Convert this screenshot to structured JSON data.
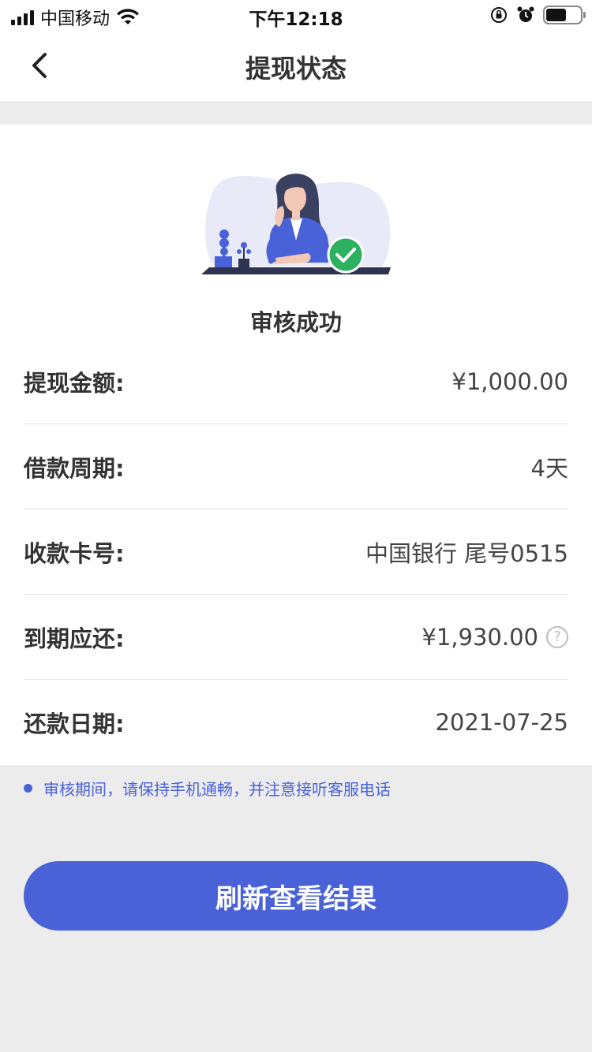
{
  "status_bar": {
    "carrier": "中国移动",
    "time": "下午12:18"
  },
  "nav": {
    "title": "提现状态",
    "back_icon": "chevron-left-icon"
  },
  "status": {
    "text": "审核成功",
    "icon": "check-circle-icon",
    "accent": "#2eb061"
  },
  "details": {
    "rows": [
      {
        "label": "提现金额:",
        "value": "¥1,000.00"
      },
      {
        "label": "借款周期:",
        "value": "4天"
      },
      {
        "label": "收款卡号:",
        "value": "中国银行 尾号0515"
      },
      {
        "label": "到期应还:",
        "value": "¥1,930.00"
      },
      {
        "label": "还款日期:",
        "value": "2021-07-25"
      }
    ]
  },
  "notice": {
    "text": "审核期间，请保持手机通畅，并注意接听客服电话"
  },
  "button": {
    "label": "刷新查看结果"
  },
  "colors": {
    "primary": "#4a62d8",
    "background": "#ececec",
    "card": "#ffffff"
  }
}
